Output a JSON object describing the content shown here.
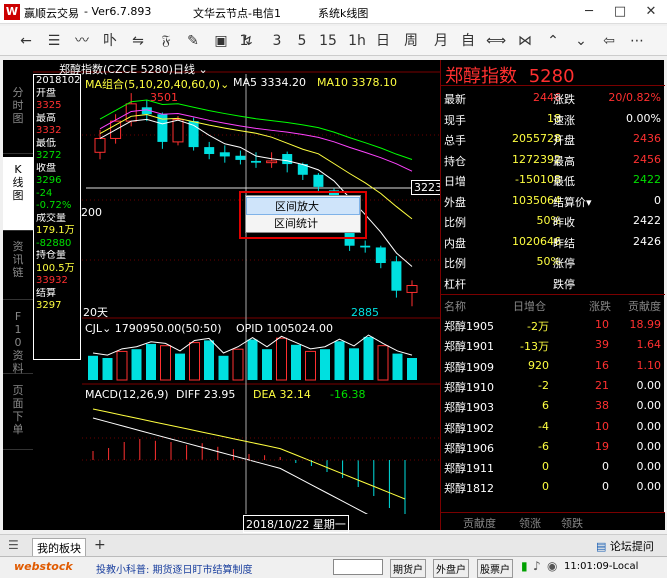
{
  "window": {
    "app_name": "赢顺云交易",
    "version": "- Ver6.7.893",
    "server": "文华云节点-电信1",
    "title": "系统k线图",
    "controls": [
      "─",
      "□",
      "✕"
    ]
  },
  "toolbar": {
    "items": [
      {
        "name": "back-icon",
        "glyph": "←"
      },
      {
        "name": "list-icon",
        "glyph": "☰"
      },
      {
        "name": "line-chart-icon",
        "glyph": "〰"
      },
      {
        "name": "split-icon",
        "glyph": "卟"
      },
      {
        "name": "arrows-icon",
        "glyph": "⇋"
      },
      {
        "name": "kline-icon",
        "glyph": "𝔉"
      },
      {
        "name": "pen-icon",
        "glyph": "✎"
      },
      {
        "name": "save-icon",
        "glyph": "▣"
      },
      {
        "name": "draw-icon",
        "glyph": "↯"
      },
      {
        "name": "period-1",
        "glyph": "1"
      },
      {
        "name": "period-3",
        "glyph": "3"
      },
      {
        "name": "period-5",
        "glyph": "5"
      },
      {
        "name": "period-15",
        "glyph": "15"
      },
      {
        "name": "period-1h",
        "glyph": "1h"
      },
      {
        "name": "period-day",
        "glyph": "日"
      },
      {
        "name": "period-week",
        "glyph": "周"
      },
      {
        "name": "period-month",
        "glyph": "月"
      },
      {
        "name": "period-custom",
        "glyph": "自"
      },
      {
        "name": "expand-icon",
        "glyph": "⟺"
      },
      {
        "name": "shrink-icon",
        "glyph": "⋈"
      },
      {
        "name": "collapse-icon",
        "glyph": "⌃"
      },
      {
        "name": "expand-up-icon",
        "glyph": "⌄"
      },
      {
        "name": "prev-icon",
        "glyph": "⇦"
      },
      {
        "name": "more-icon",
        "glyph": "⋯"
      }
    ]
  },
  "side_tabs": [
    {
      "label": "分时图",
      "active": false
    },
    {
      "label": "K线图",
      "active": true
    },
    {
      "label": "资讯链",
      "active": false
    },
    {
      "label": "F10资料",
      "active": false
    },
    {
      "label": "页面下单",
      "active": false
    }
  ],
  "symbol_bar": {
    "symbol": "郑醇指数(CZCE 5280)",
    "period": "日线"
  },
  "info_column": [
    {
      "text": "20181022",
      "cls": "white"
    },
    {
      "text": "开盘",
      "cls": "white"
    },
    {
      "text": "3325",
      "cls": "red"
    },
    {
      "text": "最高",
      "cls": "white"
    },
    {
      "text": "3332",
      "cls": "red"
    },
    {
      "text": "最低",
      "cls": "white"
    },
    {
      "text": "3272",
      "cls": "green"
    },
    {
      "text": "收盘",
      "cls": "white"
    },
    {
      "text": "3296",
      "cls": "green"
    },
    {
      "text": "-24",
      "cls": "green"
    },
    {
      "text": "-0.72%",
      "cls": "green"
    },
    {
      "text": "成交量",
      "cls": "white"
    },
    {
      "text": "179.1万",
      "cls": "yellow"
    },
    {
      "text": "-82880",
      "cls": "green"
    },
    {
      "text": "持仓量",
      "cls": "white"
    },
    {
      "text": "100.5万",
      "cls": "yellow"
    },
    {
      "text": "33932",
      "cls": "red"
    },
    {
      "text": "结算",
      "cls": "white"
    },
    {
      "text": "3297",
      "cls": "yellow"
    }
  ],
  "main_chart": {
    "ma_header": "MA组合(5,10,20,40,60,0)",
    "ma5": "MA5 3334.20",
    "ma10": "MA10 3378.10",
    "high_label": "3501",
    "low_label": "2885",
    "price_tag": "3223",
    "left_label": "200",
    "days_label": "20天",
    "candles": [
      {
        "o": 3330,
        "c": 3370,
        "h": 3395,
        "l": 3310
      },
      {
        "o": 3370,
        "c": 3420,
        "h": 3440,
        "l": 3355
      },
      {
        "o": 3420,
        "c": 3470,
        "h": 3501,
        "l": 3405
      },
      {
        "o": 3460,
        "c": 3440,
        "h": 3480,
        "l": 3420
      },
      {
        "o": 3440,
        "c": 3360,
        "h": 3445,
        "l": 3340
      },
      {
        "o": 3360,
        "c": 3425,
        "h": 3435,
        "l": 3350
      },
      {
        "o": 3420,
        "c": 3345,
        "h": 3430,
        "l": 3335
      },
      {
        "o": 3345,
        "c": 3325,
        "h": 3360,
        "l": 3310
      },
      {
        "o": 3330,
        "c": 3318,
        "h": 3350,
        "l": 3300
      },
      {
        "o": 3320,
        "c": 3308,
        "h": 3335,
        "l": 3295
      },
      {
        "o": 3305,
        "c": 3300,
        "h": 3330,
        "l": 3285
      },
      {
        "o": 3300,
        "c": 3305,
        "h": 3330,
        "l": 3285
      },
      {
        "o": 3325,
        "c": 3296,
        "h": 3332,
        "l": 3272
      },
      {
        "o": 3296,
        "c": 3265,
        "h": 3300,
        "l": 3250
      },
      {
        "o": 3265,
        "c": 3230,
        "h": 3270,
        "l": 3215
      },
      {
        "o": 3220,
        "c": 3140,
        "h": 3225,
        "l": 3120
      },
      {
        "o": 3140,
        "c": 3060,
        "h": 3145,
        "l": 3045
      },
      {
        "o": 3060,
        "c": 3055,
        "h": 3075,
        "l": 3040
      },
      {
        "o": 3055,
        "c": 3010,
        "h": 3060,
        "l": 2995
      },
      {
        "o": 3015,
        "c": 2930,
        "h": 3030,
        "l": 2910
      },
      {
        "o": 2925,
        "c": 2945,
        "h": 2960,
        "l": 2885
      }
    ]
  },
  "volume_chart": {
    "header_cji": "CJL",
    "header_cji_val": "1790950.00(50:50)",
    "header_opid": "OPID 1005024.00",
    "bars": [
      0.55,
      0.5,
      0.65,
      0.7,
      0.82,
      0.78,
      0.6,
      0.85,
      0.9,
      0.55,
      0.7,
      0.92,
      0.7,
      0.95,
      0.8,
      0.65,
      0.7,
      0.88,
      0.72,
      0.98,
      0.78,
      0.6,
      0.5
    ],
    "up": [
      false,
      false,
      true,
      false,
      false,
      true,
      false,
      true,
      false,
      false,
      true,
      false,
      false,
      true,
      false,
      true,
      false,
      false,
      false,
      false,
      true,
      false,
      false
    ]
  },
  "macd_chart": {
    "header": "MACD(12,26,9)",
    "diff": "DIFF 23.95",
    "dea": "DEA 32.14",
    "macd": "-16.38",
    "hist": [
      0.15,
      0.2,
      0.3,
      0.35,
      0.32,
      0.3,
      0.25,
      0.28,
      0.22,
      0.18,
      0.1,
      0.08,
      0.05,
      -0.05,
      -0.1,
      -0.2,
      -0.3,
      -0.45,
      -0.6,
      -0.8,
      -0.95
    ]
  },
  "xaxis": {
    "date": "2018/10/22 星期一"
  },
  "context_menu": {
    "items": [
      {
        "label": "区间放大",
        "highlighted": true
      },
      {
        "label": "区间统计",
        "highlighted": false
      }
    ]
  },
  "right_panel": {
    "title": "郑醇指数",
    "code": "5280",
    "quote_rows": [
      [
        {
          "t": "最新",
          "c": "white"
        },
        {
          "t": "2446",
          "c": "red"
        },
        {
          "t": "涨跌",
          "c": "white"
        },
        {
          "t": "20/0.82%",
          "c": "red"
        }
      ],
      [
        {
          "t": "现手",
          "c": "white"
        },
        {
          "t": "18",
          "c": "yellow"
        },
        {
          "t": "速涨",
          "c": "white"
        },
        {
          "t": "0.00%",
          "c": "white"
        }
      ],
      [
        {
          "t": "总手",
          "c": "white"
        },
        {
          "t": "2055728",
          "c": "yellow"
        },
        {
          "t": "开盘",
          "c": "white"
        },
        {
          "t": "2436",
          "c": "red"
        }
      ],
      [
        {
          "t": "持仓",
          "c": "white"
        },
        {
          "t": "1272392",
          "c": "yellow"
        },
        {
          "t": "最高",
          "c": "white"
        },
        {
          "t": "2456",
          "c": "red"
        }
      ],
      [
        {
          "t": "日增",
          "c": "white"
        },
        {
          "t": "-150108",
          "c": "yellow"
        },
        {
          "t": "最低",
          "c": "white"
        },
        {
          "t": "2422",
          "c": "green"
        }
      ],
      [
        {
          "t": "外盘",
          "c": "white"
        },
        {
          "t": "1035064",
          "c": "yellow"
        },
        {
          "t": "结算价▾",
          "c": "white"
        },
        {
          "t": "0",
          "c": "white"
        }
      ],
      [
        {
          "t": "比例",
          "c": "white"
        },
        {
          "t": "50%",
          "c": "yellow"
        },
        {
          "t": "昨收",
          "c": "white"
        },
        {
          "t": "2422",
          "c": "white"
        }
      ],
      [
        {
          "t": "内盘",
          "c": "white"
        },
        {
          "t": "1020646",
          "c": "yellow"
        },
        {
          "t": "昨结",
          "c": "white"
        },
        {
          "t": "2426",
          "c": "white"
        }
      ],
      [
        {
          "t": "比例",
          "c": "white"
        },
        {
          "t": "50%",
          "c": "yellow"
        },
        {
          "t": "涨停",
          "c": "white"
        },
        {
          "t": "",
          "c": "white"
        }
      ],
      [
        {
          "t": "杠杆",
          "c": "white"
        },
        {
          "t": "",
          "c": "white"
        },
        {
          "t": "跌停",
          "c": "white"
        },
        {
          "t": "",
          "c": "white"
        }
      ]
    ],
    "table_header": [
      "名称",
      "日增仓",
      "涨跌",
      "贡献度"
    ],
    "table_rows": [
      {
        "name": "郑醇1905",
        "zc": "-2万",
        "zc_c": "yellow",
        "zd": "10",
        "zd_c": "red",
        "gx": "18.99",
        "gx_c": "red"
      },
      {
        "name": "郑醇1901",
        "zc": "-13万",
        "zc_c": "yellow",
        "zd": "39",
        "zd_c": "red",
        "gx": "1.64",
        "gx_c": "red"
      },
      {
        "name": "郑醇1909",
        "zc": "920",
        "zc_c": "yellow",
        "zd": "16",
        "zd_c": "red",
        "gx": "1.10",
        "gx_c": "red"
      },
      {
        "name": "郑醇1910",
        "zc": "-2",
        "zc_c": "yellow",
        "zd": "21",
        "zd_c": "red",
        "gx": "0.00",
        "gx_c": "white"
      },
      {
        "name": "郑醇1903",
        "zc": "6",
        "zc_c": "yellow",
        "zd": "38",
        "zd_c": "red",
        "gx": "0.00",
        "gx_c": "white"
      },
      {
        "name": "郑醇1902",
        "zc": "-4",
        "zc_c": "yellow",
        "zd": "10",
        "zd_c": "red",
        "gx": "0.00",
        "gx_c": "white"
      },
      {
        "name": "郑醇1906",
        "zc": "-6",
        "zc_c": "yellow",
        "zd": "19",
        "zd_c": "red",
        "gx": "0.00",
        "gx_c": "white"
      },
      {
        "name": "郑醇1911",
        "zc": "0",
        "zc_c": "yellow",
        "zd": "0",
        "zd_c": "white",
        "gx": "0.00",
        "gx_c": "white"
      },
      {
        "name": "郑醇1812",
        "zc": "0",
        "zc_c": "yellow",
        "zd": "0",
        "zd_c": "white",
        "gx": "0.00",
        "gx_c": "white"
      }
    ],
    "bottom_tabs": [
      "贡献度",
      "领涨",
      "领跌"
    ]
  },
  "tabbar": {
    "tab": "我的板块",
    "add": "+",
    "forum": "论坛提问"
  },
  "statusbar": {
    "brand": "webstock",
    "tip": "投教小科普: 期货逐日盯市结算制度",
    "btn1": "期货户",
    "btn2": "外盘户",
    "btn3": "股票户",
    "time": "11:01:09-Local"
  }
}
